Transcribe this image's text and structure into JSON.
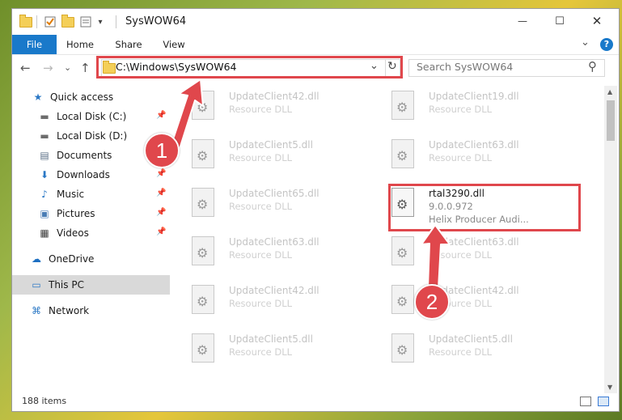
{
  "window": {
    "title": "SysWOW64",
    "controls": {
      "minimize": "—",
      "maximize": "☐",
      "close": "✕"
    }
  },
  "quick_access_toolbar": {
    "dropdown_glyph": "▾"
  },
  "ribbon": {
    "tabs": [
      "File",
      "Home",
      "Share",
      "View"
    ],
    "expand_glyph": "⌄",
    "help_glyph": "?"
  },
  "address_bar": {
    "back_glyph": "←",
    "forward_glyph": "→",
    "recent_glyph": "⌄",
    "up_glyph": "↑",
    "path": "C:\\Windows\\SysWOW64",
    "dropdown_glyph": "⌄",
    "refresh_glyph": "↻"
  },
  "search": {
    "placeholder": "Search SysWOW64",
    "icon_glyph": "⚲"
  },
  "nav_pane": {
    "items": [
      {
        "label": "Quick access",
        "icon": "star-icon",
        "glyph": "★",
        "color": "#2b78c5",
        "pinned": false,
        "selected": false
      },
      {
        "label": "Local Disk (C:)",
        "icon": "drive-icon",
        "glyph": "▬",
        "color": "#6d6d6d",
        "pinned": true,
        "selected": false
      },
      {
        "label": "Local Disk (D:)",
        "icon": "drive-icon",
        "glyph": "▬",
        "color": "#6d6d6d",
        "pinned": true,
        "selected": false
      },
      {
        "label": "Documents",
        "icon": "documents-icon",
        "glyph": "▤",
        "color": "#5b6f86",
        "pinned": true,
        "selected": false
      },
      {
        "label": "Downloads",
        "icon": "downloads-icon",
        "glyph": "⬇",
        "color": "#2b78c5",
        "pinned": true,
        "selected": false
      },
      {
        "label": "Music",
        "icon": "music-icon",
        "glyph": "♪",
        "color": "#2b78c5",
        "pinned": true,
        "selected": false
      },
      {
        "label": "Pictures",
        "icon": "pictures-icon",
        "glyph": "▣",
        "color": "#4a7db5",
        "pinned": true,
        "selected": false
      },
      {
        "label": "Videos",
        "icon": "videos-icon",
        "glyph": "▦",
        "color": "#3c3c3c",
        "pinned": true,
        "selected": false
      },
      {
        "label": "OneDrive",
        "icon": "onedrive-icon",
        "glyph": "☁",
        "color": "#1d6fc2",
        "pinned": false,
        "selected": false
      },
      {
        "label": "This PC",
        "icon": "computer-icon",
        "glyph": "▭",
        "color": "#2b78c5",
        "pinned": false,
        "selected": true
      },
      {
        "label": "Network",
        "icon": "network-icon",
        "glyph": "⌘",
        "color": "#2b78c5",
        "pinned": false,
        "selected": false
      }
    ],
    "pin_glyph": "📌"
  },
  "files": {
    "left_column": [
      {
        "name": "UpdateClient42.dll",
        "type": "Resource DLL"
      },
      {
        "name": "UpdateClient5.dll",
        "type": "Resource DLL"
      },
      {
        "name": "UpdateClient65.dll",
        "type": "Resource DLL"
      },
      {
        "name": "UpdateClient63.dll",
        "type": "Resource DLL"
      },
      {
        "name": "UpdateClient42.dll",
        "type": "Resource DLL"
      },
      {
        "name": "UpdateClient5.dll",
        "type": "Resource DLL"
      }
    ],
    "right_column": [
      {
        "name": "UpdateClient19.dll",
        "type": "Resource DLL"
      },
      {
        "name": "UpdateClient63.dll",
        "type": "Resource DLL"
      },
      {
        "name": "rtal3290.dll",
        "type": "9.0.0.972",
        "company": "Helix Producer Audi...",
        "focus": true
      },
      {
        "name": "UpdateClient63.dll",
        "type": "Resource DLL"
      },
      {
        "name": "UpdateClient42.dll",
        "type": "Resource DLL"
      },
      {
        "name": "UpdateClient5.dll",
        "type": "Resource DLL"
      }
    ]
  },
  "status_bar": {
    "item_count": "188 items"
  },
  "annotations": {
    "step1_label": "1",
    "step2_label": "2",
    "highlight_color": "#e0474c"
  }
}
